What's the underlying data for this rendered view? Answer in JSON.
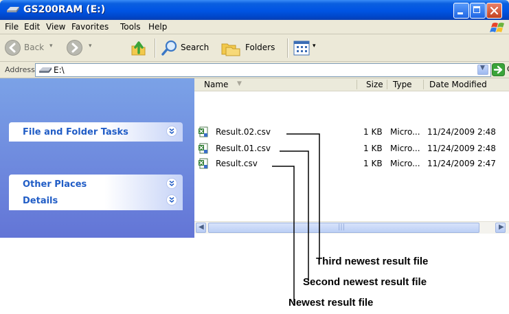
{
  "window": {
    "title": "GS200RAM (E:)",
    "title_icon": "drive-icon",
    "controls": [
      "minimize",
      "maximize",
      "close"
    ]
  },
  "menubar": {
    "items": [
      "File",
      "Edit",
      "View",
      "Favorites",
      "Tools",
      "Help"
    ]
  },
  "toolbar": {
    "back_label": "Back",
    "search_label": "Search",
    "folders_label": "Folders"
  },
  "address": {
    "label": "Address",
    "value": "E:\\",
    "go_label": "Go"
  },
  "left_pane": {
    "panels": [
      "File and Folder Tasks",
      "Other Places",
      "Details"
    ]
  },
  "file_list": {
    "columns": [
      "Name",
      "Size",
      "Type",
      "Date Modified"
    ],
    "rows": [
      {
        "name": "Result.02.csv",
        "size": "1 KB",
        "type": "Micro...",
        "date": "11/24/2009 2:48"
      },
      {
        "name": "Result.01.csv",
        "size": "1 KB",
        "type": "Micro...",
        "date": "11/24/2009 2:48"
      },
      {
        "name": "Result.csv",
        "size": "1 KB",
        "type": "Micro...",
        "date": "11/24/2009 2:47"
      }
    ]
  },
  "annotations": {
    "third": "Third newest result file",
    "second": "Second newest result file",
    "newest": "Newest result file"
  },
  "colors": {
    "titlebar": "#0054e3",
    "taskpane": "#6375d6",
    "panel_title": "#215dc6"
  }
}
